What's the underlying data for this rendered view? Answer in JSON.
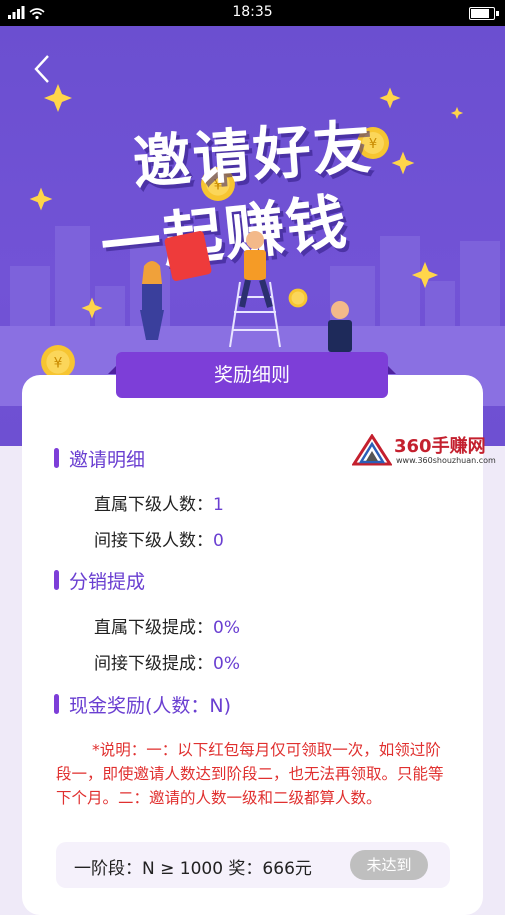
{
  "status_bar": {
    "time": "18:35"
  },
  "hero": {
    "title_line1": "邀请好友",
    "title_line2": "一起赚钱",
    "back_label": "‹"
  },
  "rules_tab": {
    "label": "奖励细则"
  },
  "sections": {
    "invite": {
      "title": "邀请明细",
      "direct_label": "直属下级人数：",
      "direct_value": "1",
      "indirect_label": "间接下级人数：",
      "indirect_value": "0"
    },
    "commission": {
      "title": "分销提成",
      "direct_label": "直属下级提成：",
      "direct_value": "0%",
      "indirect_label": "间接下级提成：",
      "indirect_value": "0%"
    },
    "cash": {
      "title": "现金奖励(人数：N)",
      "note": "*说明：一：以下红包每月仅可领取一次，如领过阶段一，即使邀请人数达到阶段二，也无法再领取。只能等下个月。二：邀请的人数一级和二级都算人数。",
      "stage1_text": "一阶段：N ≥ 1000 奖：666元",
      "stage1_button": "未达到"
    }
  },
  "watermark": {
    "brand": "360手赚网",
    "url": "www.360shouzhuan.com"
  },
  "colors": {
    "accent": "#7d3ed8",
    "hero_bg": "#6b4fd0",
    "note_red": "#e0302f",
    "disabled_gray": "#bfbfbf"
  }
}
